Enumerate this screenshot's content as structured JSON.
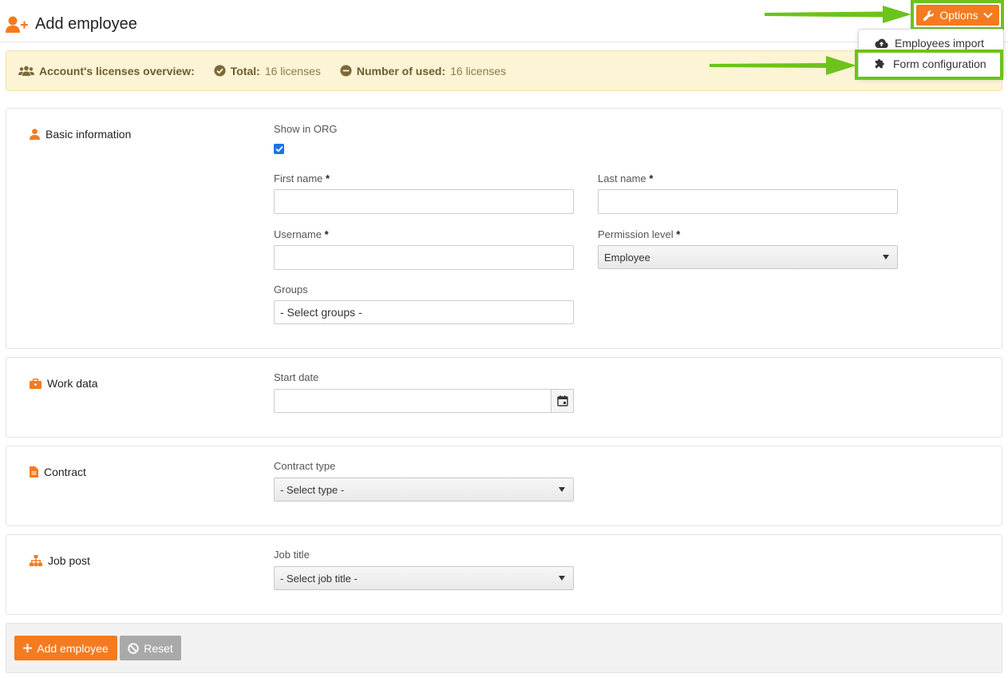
{
  "header": {
    "title": "Add employee",
    "options_label": "Options"
  },
  "options_menu": {
    "items": [
      {
        "label": "Employees import",
        "icon": "cloud-upload-icon"
      },
      {
        "label": "Form configuration",
        "icon": "puzzle-icon"
      }
    ]
  },
  "licenses": {
    "overview_label": "Account's licenses overview:",
    "total_label": "Total:",
    "total_value": "16 licenses",
    "used_label": "Number of used:",
    "used_value": "16 licenses"
  },
  "sections": {
    "basic": {
      "title": "Basic information",
      "show_in_org_label": "Show in ORG",
      "show_in_org_checked": true,
      "first_name_label": "First name",
      "last_name_label": "Last name",
      "username_label": "Username",
      "permission_label": "Permission level",
      "permission_value": "Employee",
      "groups_label": "Groups",
      "groups_placeholder": "- Select groups -",
      "required_mark": "*"
    },
    "work": {
      "title": "Work data",
      "start_date_label": "Start date"
    },
    "contract": {
      "title": "Contract",
      "contract_type_label": "Contract type",
      "contract_type_value": "- Select type -"
    },
    "job": {
      "title": "Job post",
      "job_title_label": "Job title",
      "job_title_value": "- Select job title -"
    }
  },
  "footer": {
    "add_label": "Add employee",
    "reset_label": "Reset"
  },
  "colors": {
    "accent": "#f47b20",
    "highlight": "#6cc31b",
    "license_bg": "#fcf4d4",
    "checkbox": "#1a73e8"
  }
}
